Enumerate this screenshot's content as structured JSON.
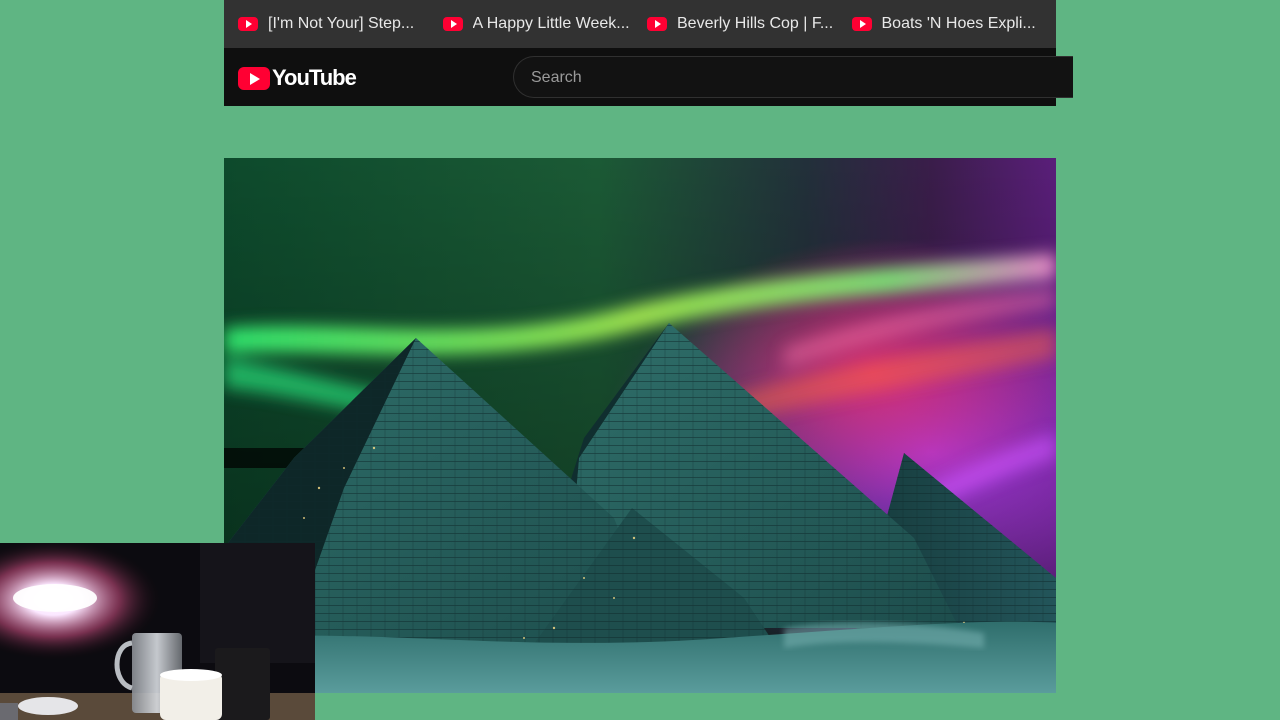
{
  "bookmarks": [
    {
      "label": "[I'm Not Your] Step...",
      "icon": "youtube-icon"
    },
    {
      "label": "A Happy Little Week...",
      "icon": "youtube-icon"
    },
    {
      "label": "Beverly Hills Cop | F...",
      "icon": "youtube-icon"
    },
    {
      "label": "Boats 'N Hoes Expli...",
      "icon": "youtube-icon"
    }
  ],
  "header": {
    "logo_text": "YouTube",
    "search_placeholder": "Search"
  },
  "colors": {
    "page_background": "#5fb583",
    "bookmarks_bar": "#323232",
    "header": "#0f0f0f",
    "brand_red": "#ff0033"
  }
}
